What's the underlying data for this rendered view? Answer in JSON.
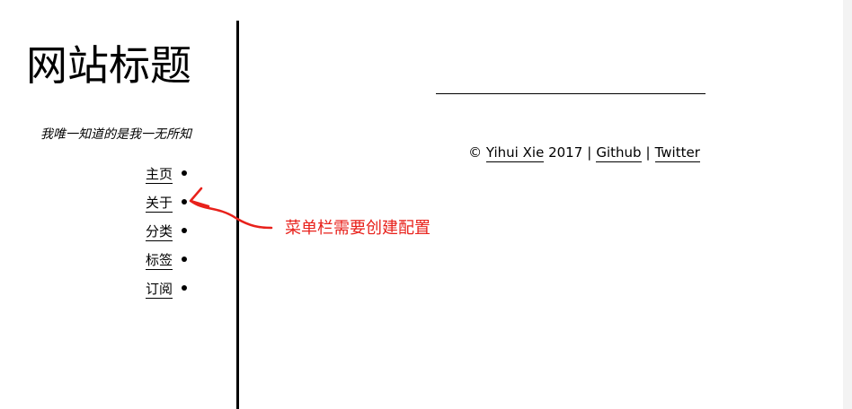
{
  "sidebar": {
    "site_title": "网站标题",
    "tagline": "我唯一知道的是我一无所知",
    "nav": [
      {
        "label": "主页"
      },
      {
        "label": "关于"
      },
      {
        "label": "分类"
      },
      {
        "label": "标签"
      },
      {
        "label": "订阅"
      }
    ]
  },
  "footer": {
    "copyright_symbol": "©",
    "author": "Yihui Xie",
    "year": "2017",
    "separator": "|",
    "links": [
      {
        "label": "Github"
      },
      {
        "label": "Twitter"
      }
    ]
  },
  "annotation": {
    "text": "菜单栏需要创建配置",
    "color": "#e8211b"
  },
  "colors": {
    "background": "#ffffff",
    "text": "#000000",
    "annotation": "#e8211b"
  }
}
